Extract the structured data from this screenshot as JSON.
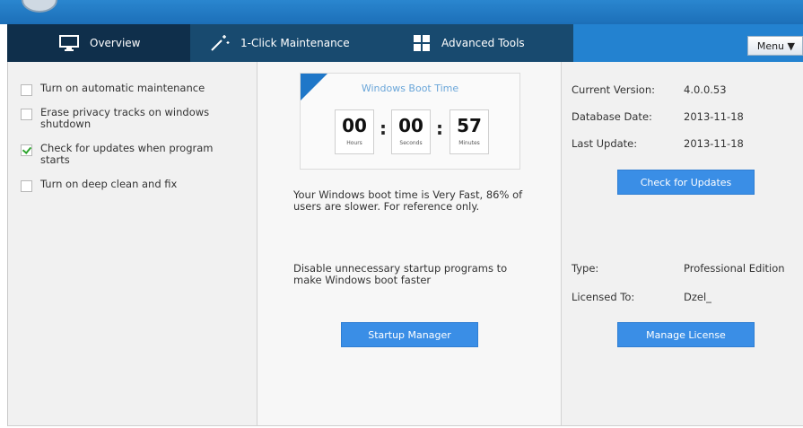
{
  "nav": {
    "tabs": [
      {
        "label": "Overview",
        "icon": "monitor-icon"
      },
      {
        "label": "1-Click Maintenance",
        "icon": "magic-wand-icon"
      },
      {
        "label": "Advanced Tools",
        "icon": "grid-icon"
      }
    ],
    "menu_label": "Menu ▼"
  },
  "options": [
    {
      "label": "Turn on automatic maintenance",
      "checked": false
    },
    {
      "label": "Erase privacy tracks on windows shutdown",
      "checked": false
    },
    {
      "label": "Check for updates when program starts",
      "checked": true
    },
    {
      "label": "Turn on deep clean and fix",
      "checked": false
    }
  ],
  "boot": {
    "title": "Windows Boot Time",
    "hours": "00",
    "hours_unit": "Hours",
    "seconds": "00",
    "seconds_unit": "Seconds",
    "minutes": "57",
    "minutes_unit": "Minutes",
    "message": "Your Windows boot time is Very Fast, 86% of users are slower. For reference only.",
    "startup_text": "Disable unnecessary startup programs to make Windows boot faster",
    "startup_button": "Startup Manager"
  },
  "info": {
    "current_version_label": "Current Version:",
    "current_version": "4.0.0.53",
    "database_date_label": "Database Date:",
    "database_date": "2013-11-18",
    "last_update_label": "Last Update:",
    "last_update": "2013-11-18",
    "check_updates_button": "Check for Updates",
    "type_label": "Type:",
    "type": "Professional Edition",
    "licensed_to_label": "Licensed To:",
    "licensed_to": "Dzel_",
    "manage_license_button": "Manage License"
  },
  "colors": {
    "title_bar": "#2080cc",
    "nav_bar": "#184a6f",
    "nav_active": "#0f2f4b",
    "button_blue": "#3a8ee6",
    "check_green": "#2ea52e"
  }
}
